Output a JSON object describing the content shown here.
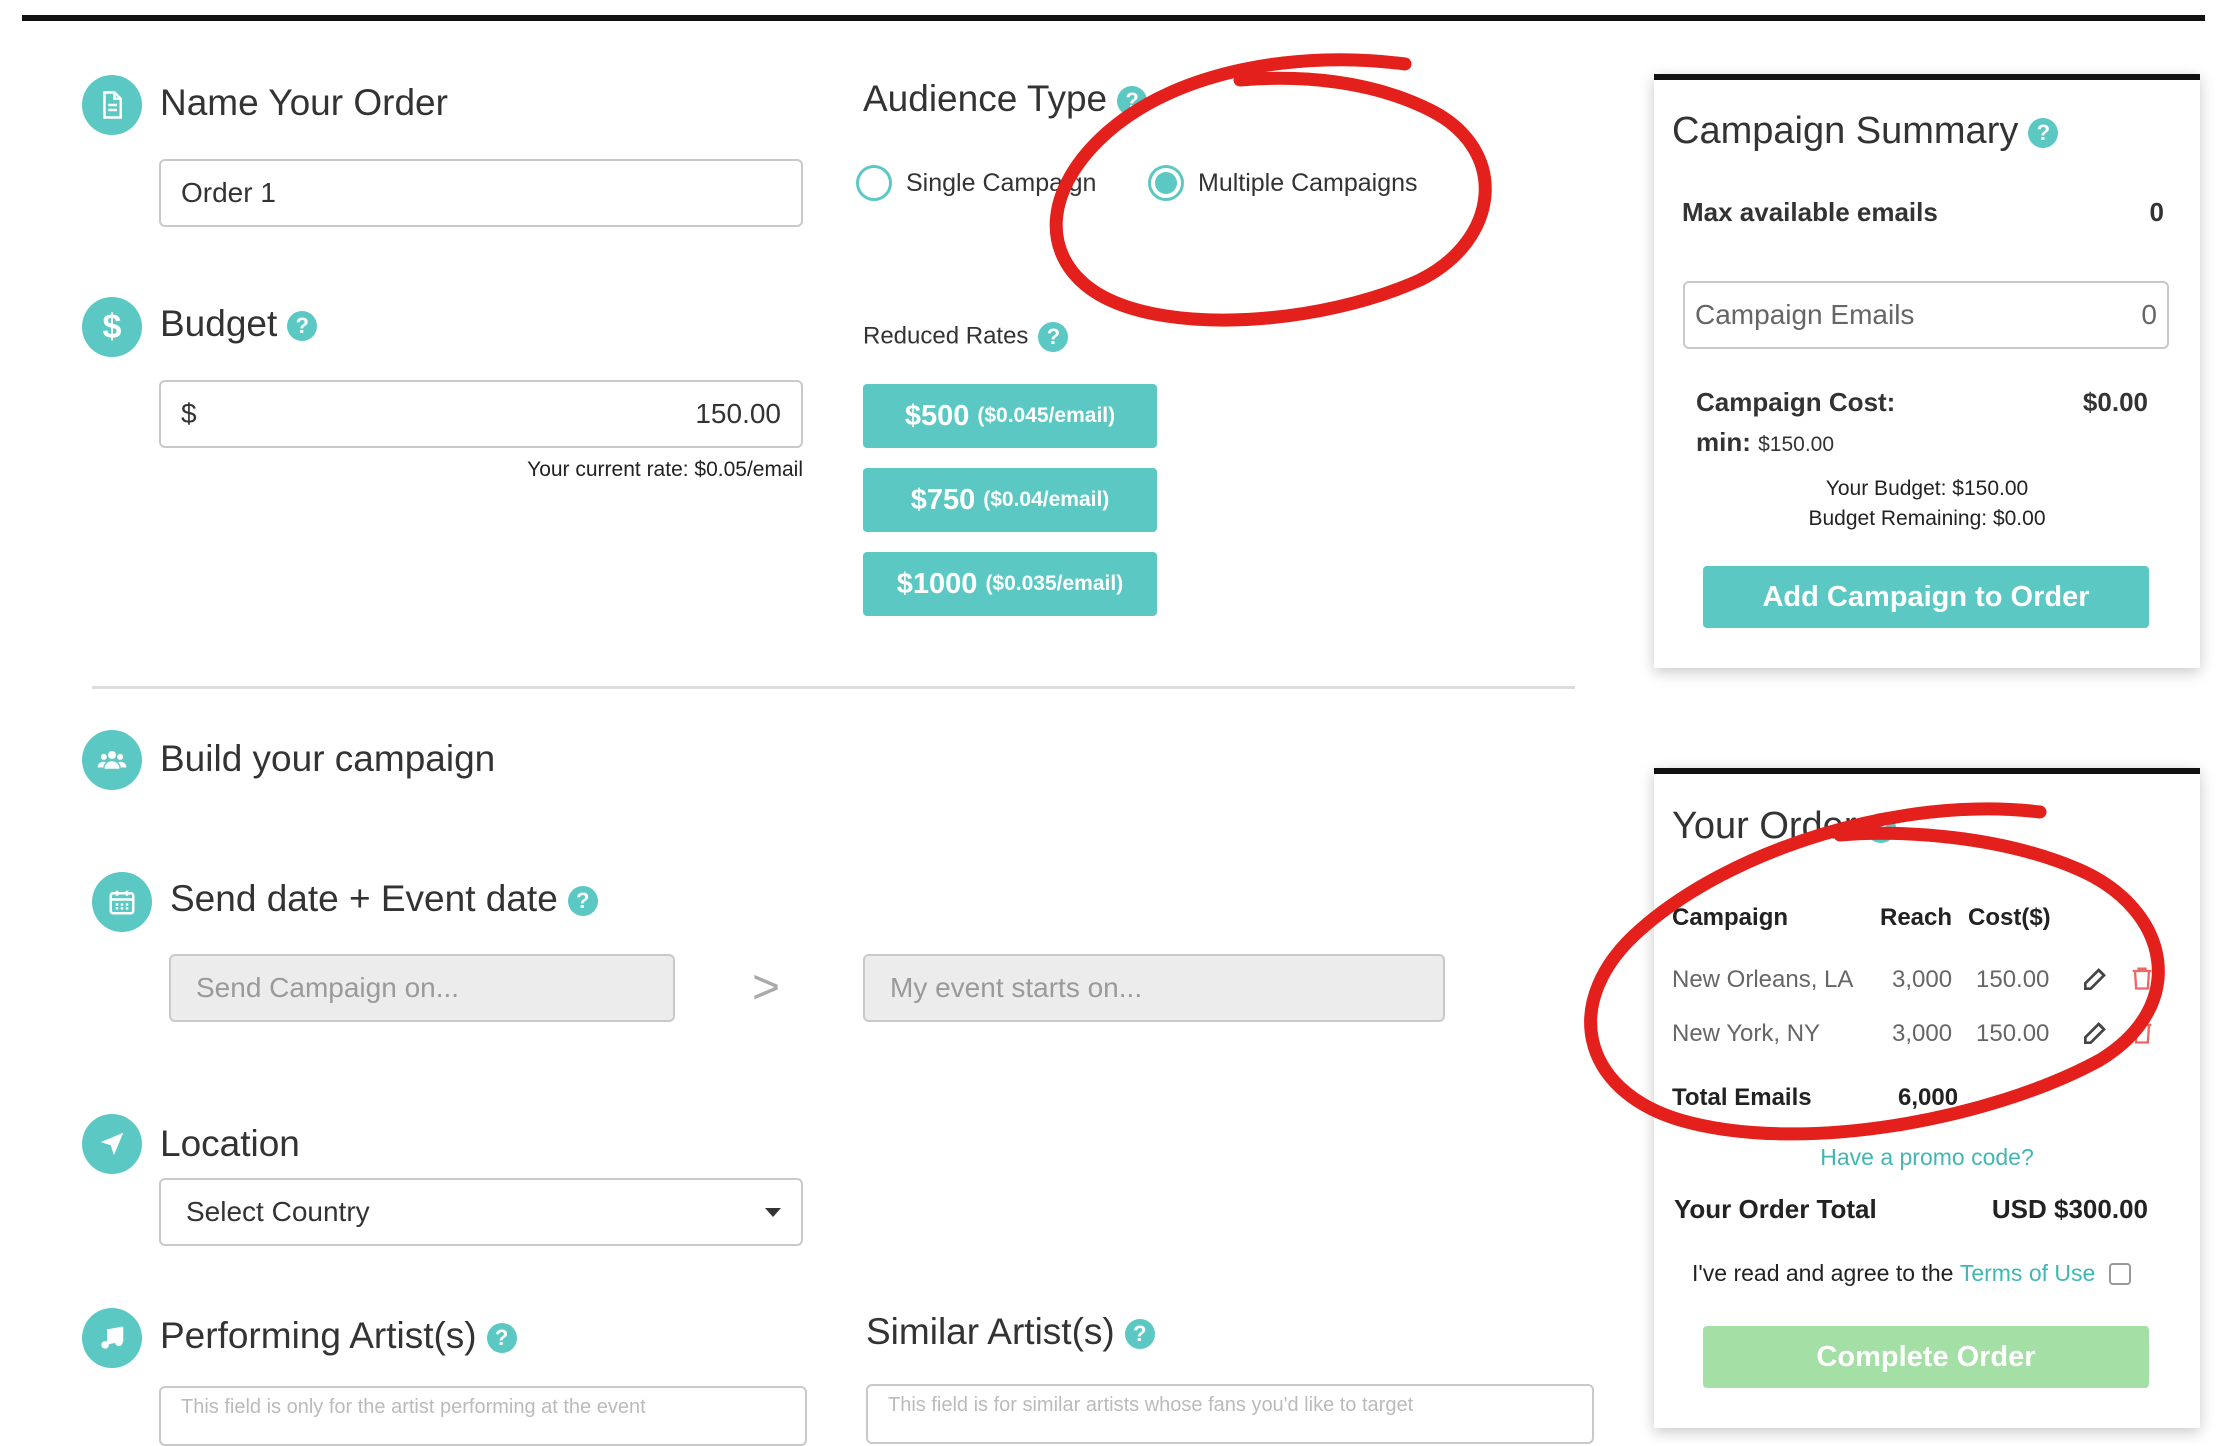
{
  "name_order": {
    "title": "Name Your Order",
    "input_value": "Order 1"
  },
  "audience": {
    "title": "Audience Type",
    "options": [
      {
        "label": "Single Campaign",
        "selected": false
      },
      {
        "label": "Multiple Campaigns",
        "selected": true
      }
    ]
  },
  "budget": {
    "title": "Budget",
    "currency_symbol": "$",
    "value": "150.00",
    "current_rate": "Your current rate: $0.05/email"
  },
  "reduced_rates": {
    "title": "Reduced Rates",
    "buttons": [
      {
        "amount": "$500",
        "rate": "($0.045/email)"
      },
      {
        "amount": "$750",
        "rate": "($0.04/email)"
      },
      {
        "amount": "$1000",
        "rate": "($0.035/email)"
      }
    ]
  },
  "build": {
    "title": "Build your campaign"
  },
  "dates": {
    "title": "Send date + Event date",
    "send_placeholder": "Send Campaign on...",
    "arrow": ">",
    "event_placeholder": "My event starts on..."
  },
  "location": {
    "title": "Location",
    "select_value": "Select Country"
  },
  "performing": {
    "title": "Performing Artist(s)",
    "placeholder": "This field is only for the artist performing at the event"
  },
  "similar": {
    "title": "Similar Artist(s)",
    "placeholder": "This field is for similar artists whose fans you'd like to target"
  },
  "summary": {
    "title": "Campaign Summary",
    "max_label": "Max available emails",
    "max_value": "0",
    "emails_placeholder": "Campaign Emails",
    "emails_value": "0",
    "cost_label": "Campaign Cost:",
    "cost_value": "$0.00",
    "min_label": "min:",
    "min_value": "$150.00",
    "your_budget": "Your Budget: $150.00",
    "budget_remaining": "Budget Remaining: $0.00",
    "add_button": "Add Campaign to Order"
  },
  "order": {
    "title": "Your Order",
    "headers": {
      "campaign": "Campaign",
      "reach": "Reach",
      "cost": "Cost($)"
    },
    "rows": [
      {
        "campaign": "New Orleans, LA",
        "reach": "3,000",
        "cost": "150.00"
      },
      {
        "campaign": "New York, NY",
        "reach": "3,000",
        "cost": "150.00"
      }
    ],
    "total_emails_label": "Total Emails",
    "total_emails_value": "6,000",
    "promo_link": "Have a promo code?",
    "total_label": "Your Order Total",
    "total_value": "USD $300.00",
    "terms_prefix": "I've read and agree to the",
    "terms_link": "Terms of Use",
    "complete_button": "Complete Order"
  },
  "colors": {
    "accent": "#5bc8c4",
    "complete_disabled": "#a4e0a6",
    "annotation_red": "#e3201b"
  }
}
